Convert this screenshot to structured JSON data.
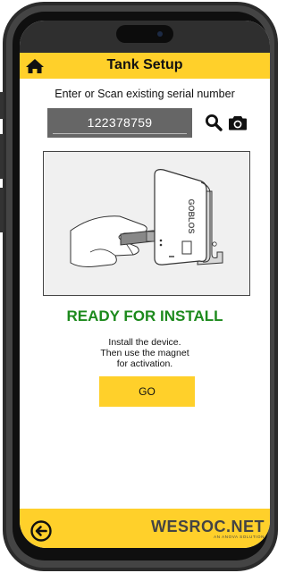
{
  "header": {
    "title": "Tank Setup",
    "home_icon": "home-icon"
  },
  "serial": {
    "prompt": "Enter or Scan existing serial number",
    "value": "122378759",
    "search_icon": "search-icon",
    "camera_icon": "camera-icon"
  },
  "device": {
    "label": "GOBLOS"
  },
  "status": {
    "title": "READY FOR INSTALL",
    "instructions": [
      "Install the device.",
      "Then use the magnet",
      "for activation."
    ]
  },
  "go_button": {
    "label": "GO"
  },
  "footer": {
    "back_icon": "back-arrow-icon",
    "brand_name": "WESROC.NET",
    "brand_tagline": "AN ANOVA SOLUTION"
  },
  "colors": {
    "accent": "#ffd02a",
    "status_green": "#1d8a1d",
    "serial_bg": "#666666"
  }
}
